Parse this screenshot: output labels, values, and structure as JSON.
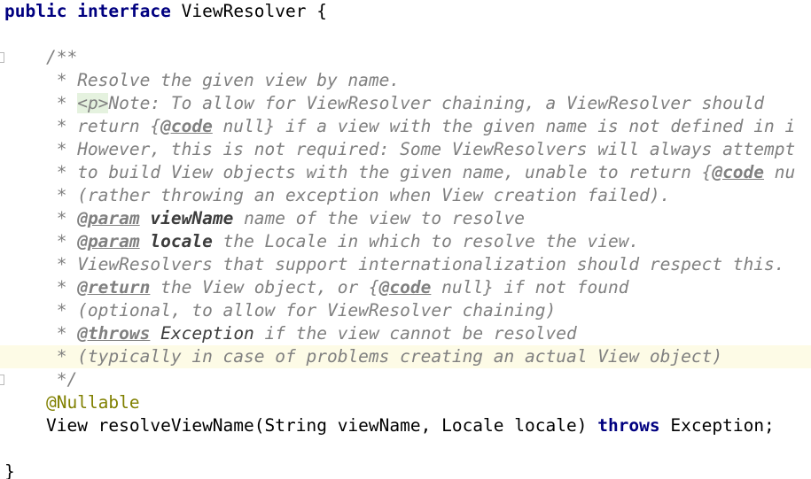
{
  "code": {
    "line1": {
      "kw_public": "public",
      "kw_interface": "interface",
      "name_text": " ViewResolver {"
    },
    "line3": {
      "text": "/**"
    },
    "line4": {
      "text": " * Resolve the given view by name."
    },
    "line5": {
      "prefix": " * ",
      "html_tag": "<p>",
      "text": "Note: To allow for ViewResolver chaining, a ViewResolver should"
    },
    "line6": {
      "prefix": " * return {",
      "tag": "@code",
      "text": " null} if a view with the given name is not defined in i"
    },
    "line7": {
      "text": " * However, this is not required: Some ViewResolvers will always attempt"
    },
    "line8": {
      "prefix": " * to build View objects with the given name, unable to return {",
      "tag": "@code",
      "text": " nu"
    },
    "line9": {
      "text": " * (rather throwing an exception when View creation failed)."
    },
    "line10": {
      "prefix": " * ",
      "tag": "@param",
      "pname": "viewName",
      "text": " name of the view to resolve"
    },
    "line11": {
      "prefix": " * ",
      "tag": "@param",
      "pname": "locale",
      "text": " the Locale in which to resolve the view."
    },
    "line12": {
      "text": " * ViewResolvers that support internationalization should respect this."
    },
    "line13": {
      "prefix": " * ",
      "tag": "@return",
      "mid": " the View object, or {",
      "tag2": "@code",
      "text": " null} if not found"
    },
    "line14": {
      "text": " * (optional, to allow for ViewResolver chaining)"
    },
    "line15": {
      "prefix": " * ",
      "tag": "@throws",
      "sep": " ",
      "ref": "Exception",
      "text": " if the view cannot be resolved"
    },
    "line16": {
      "text": " * (typically in case of problems creating an actual View object)"
    },
    "line17": {
      "text": " */"
    },
    "line18": {
      "annotation": "@Nullable"
    },
    "line19": {
      "sig": "View resolveViewName(String viewName, Locale locale) ",
      "kw_throws": "throws",
      "tail": " Exception;"
    },
    "line21": {
      "text": "}"
    }
  },
  "colors": {
    "keyword": "#000080",
    "doc_comment": "#808080",
    "annotation": "#808000",
    "caret_row": "#fdfbe6"
  }
}
